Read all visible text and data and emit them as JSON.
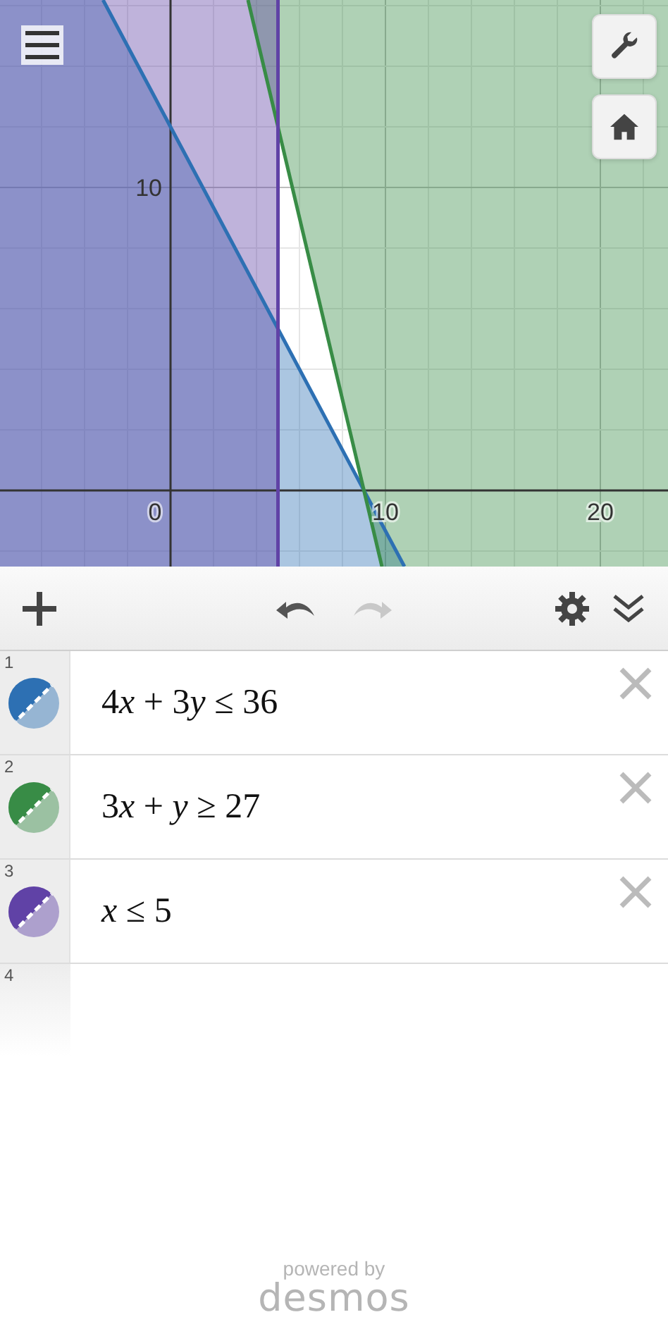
{
  "graph": {
    "x_axis_labels": [
      "0",
      "10",
      "20"
    ],
    "y_axis_labels": [
      "10"
    ]
  },
  "toolbar": {
    "undo": {
      "disabled": false
    },
    "redo": {
      "disabled": true
    }
  },
  "expressions": [
    {
      "number": "1",
      "latex": "4x + 3y ≤ 36",
      "color": "#2d70b3"
    },
    {
      "number": "2",
      "latex": "3x + y ≥ 27",
      "color": "#388c46"
    },
    {
      "number": "3",
      "latex": "x ≤ 5",
      "color": "#6042a6"
    },
    {
      "number": "4"
    }
  ],
  "footer": {
    "powered_by": "powered by",
    "brand": "desmos"
  }
}
